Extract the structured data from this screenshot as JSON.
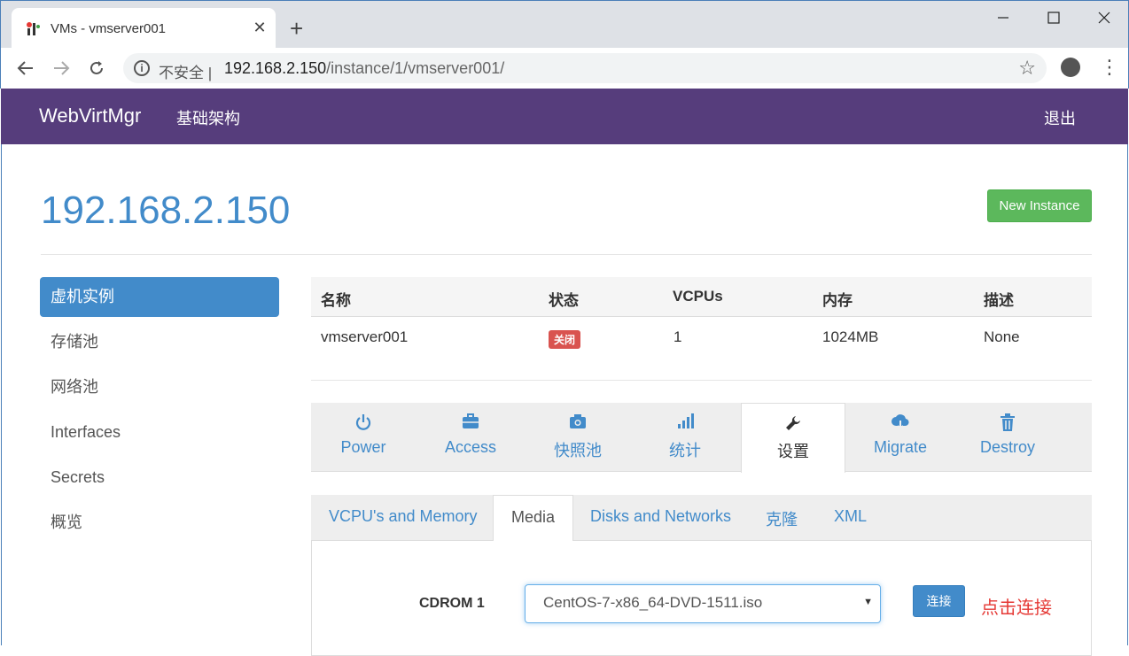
{
  "browser": {
    "tab_title": "VMs - vmserver001",
    "tab_close": "✕",
    "new_tab": "+",
    "insecure_label": "不安全 |",
    "url_host": "192.168.2.150",
    "url_path": "/instance/1/vmserver001/"
  },
  "navbar": {
    "brand": "WebVirtMgr",
    "infrastructure": "基础架构",
    "logout": "退出"
  },
  "page": {
    "host_title": "192.168.2.150",
    "new_instance": "New Instance"
  },
  "sidebar": {
    "items": [
      {
        "label": "虚机实例",
        "active": true
      },
      {
        "label": "存储池"
      },
      {
        "label": "网络池"
      },
      {
        "label": "Interfaces"
      },
      {
        "label": "Secrets"
      },
      {
        "label": "概览"
      }
    ]
  },
  "instance_table": {
    "headers": [
      "名称",
      "状态",
      "VCPUs",
      "内存",
      "描述"
    ],
    "row": {
      "name": "vmserver001",
      "status": "关闭",
      "vcpus": "1",
      "memory": "1024MB",
      "description": "None"
    },
    "status_color": "#d9534f"
  },
  "action_tabs": [
    {
      "label": "Power",
      "icon": "power-icon"
    },
    {
      "label": "Access",
      "icon": "briefcase-icon"
    },
    {
      "label": "快照池",
      "icon": "camera-icon"
    },
    {
      "label": "统计",
      "icon": "stats-icon"
    },
    {
      "label": "设置",
      "icon": "wrench-icon",
      "active": true
    },
    {
      "label": "Migrate",
      "icon": "cloud-download-icon"
    },
    {
      "label": "Destroy",
      "icon": "trash-icon"
    }
  ],
  "settings_tabs": [
    {
      "label": "VCPU's and Memory"
    },
    {
      "label": "Media",
      "active": true
    },
    {
      "label": "Disks and Networks"
    },
    {
      "label": "克隆"
    },
    {
      "label": "XML"
    }
  ],
  "media": {
    "cdrom_label": "CDROM 1",
    "selected_iso": "CentOS-7-x86_64-DVD-1511.iso",
    "connect_button": "连接",
    "annotation": "点击连接"
  },
  "colors": {
    "navbar": "#563d7c",
    "primary": "#428bca",
    "success": "#5cb85c",
    "annotation": "#e53935"
  }
}
